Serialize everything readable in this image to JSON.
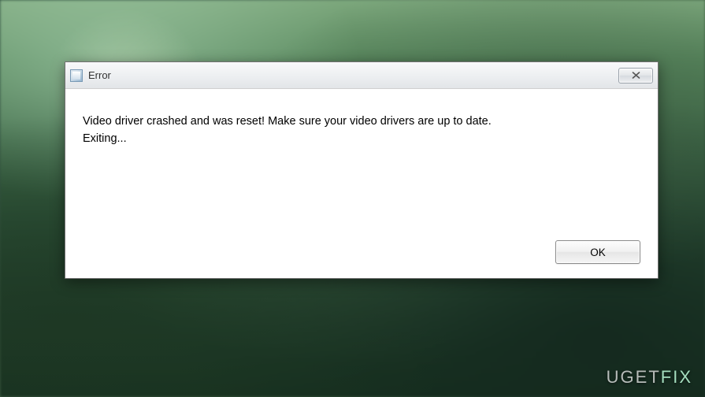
{
  "dialog": {
    "title": "Error",
    "icon_name": "app-icon",
    "message": "Video driver crashed and was reset!  Make sure your video drivers are up to date.\nExiting...",
    "close_symbol": "✕",
    "ok_label": "OK"
  },
  "watermark": {
    "brand_part1": "UGET",
    "brand_part2": "FIX"
  }
}
